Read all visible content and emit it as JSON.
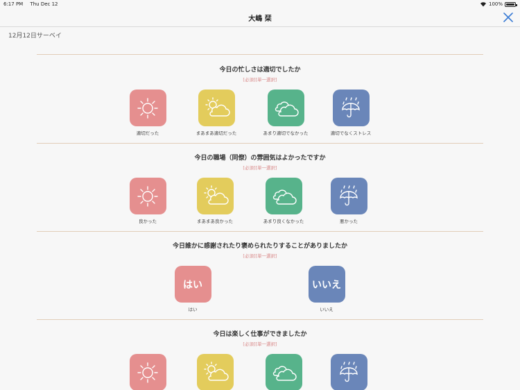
{
  "status_bar": {
    "time": "6:17 PM",
    "date": "Thu Dec 12",
    "battery": "100%"
  },
  "header": {
    "title": "大嶋 栞"
  },
  "survey": {
    "date_label": "12月12日サーベイ"
  },
  "colors": {
    "sun": "#e58f8f",
    "partly_cloudy": "#e3cc5c",
    "cloudy": "#57b38b",
    "rain": "#6a86b9",
    "accent": "#3a7bd5",
    "divider": "#e2cdb8",
    "required_note": "#d98a8a"
  },
  "questions": [
    {
      "title": "今日の忙しさは適切でしたか",
      "note": "[必須][単一選択]",
      "options": [
        {
          "label": "適切だった",
          "icon": "sun-icon"
        },
        {
          "label": "まあまあ適切だった",
          "icon": "partly-cloudy-icon"
        },
        {
          "label": "あまり適切でなかった",
          "icon": "cloud-icon"
        },
        {
          "label": "適切でなくストレス",
          "icon": "umbrella-rain-icon"
        }
      ]
    },
    {
      "title": "今日の職場（同僚）の雰囲気はよかったですか",
      "note": "[必須][単一選択]",
      "options": [
        {
          "label": "良かった",
          "icon": "sun-icon"
        },
        {
          "label": "まあまあ良かった",
          "icon": "partly-cloudy-icon"
        },
        {
          "label": "あまり良くなかった",
          "icon": "cloud-icon"
        },
        {
          "label": "悪かった",
          "icon": "umbrella-rain-icon"
        }
      ]
    },
    {
      "title": "今日誰かに感謝されたり褒められたりすることがありましたか",
      "note": "[必須][単一選択]",
      "options": [
        {
          "tile_text": "はい",
          "label": "はい"
        },
        {
          "tile_text": "いいえ",
          "label": "いいえ"
        }
      ]
    },
    {
      "title": "今日は楽しく仕事ができましたか",
      "note": "[必須][単一選択]",
      "options": [
        {
          "icon": "sun-icon"
        },
        {
          "icon": "partly-cloudy-icon"
        },
        {
          "icon": "cloud-icon"
        },
        {
          "icon": "umbrella-rain-icon"
        }
      ]
    }
  ]
}
